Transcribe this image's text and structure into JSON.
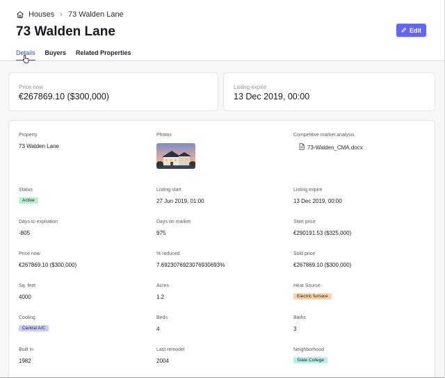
{
  "breadcrumb": {
    "section": "Houses",
    "current": "73 Walden Lane"
  },
  "page": {
    "title": "73 Walden Lane",
    "edit_label": "Edit"
  },
  "tabs": [
    {
      "label": "Details",
      "active": true
    },
    {
      "label": "Buyers",
      "active": false
    },
    {
      "label": "Related Properties",
      "active": false
    }
  ],
  "summary": {
    "price_label": "Price now",
    "price_value": "€267869.10 ($300,000)",
    "expire_label": "Listing expire",
    "expire_value": "13 Dec 2019, 00:00"
  },
  "details": {
    "property": {
      "label": "Property",
      "value": "73 Walden Lane"
    },
    "photos": {
      "label": "Photos"
    },
    "cma": {
      "label": "Competitive market analysis",
      "file": "73-Walden_CMA.docx"
    },
    "status": {
      "label": "Status",
      "value": "Active",
      "color": "#b8f0cf"
    },
    "listing_start": {
      "label": "Listing start",
      "value": "27 Jun 2019, 01:00"
    },
    "listing_expire": {
      "label": "Listing expire",
      "value": "13 Dec 2019, 00:00"
    },
    "days_to_expiration": {
      "label": "Days to expiration",
      "value": "-805"
    },
    "days_on_market": {
      "label": "Days on market",
      "value": "975"
    },
    "start_price": {
      "label": "Start price",
      "value": "€290191.53 ($325,000)"
    },
    "price_now": {
      "label": "Price now",
      "value": "€267869.10 ($300,000)"
    },
    "reduced": {
      "label": "% reduced",
      "value": "7.6923076923076930693%"
    },
    "sold_price": {
      "label": "Sold price",
      "value": "€267869.10 ($300,000)"
    },
    "sq_feet": {
      "label": "Sq. feet",
      "value": "4000"
    },
    "acres": {
      "label": "Acres",
      "value": "1.2"
    },
    "heat_source": {
      "label": "Heat Source",
      "value": "Electric furnace",
      "color": "#fdd2a6"
    },
    "cooling": {
      "label": "Cooling",
      "value": "Central A/C",
      "color": "#c9cdf7"
    },
    "beds": {
      "label": "Beds",
      "value": "4"
    },
    "baths": {
      "label": "Baths",
      "value": "3"
    },
    "built_in": {
      "label": "Built in",
      "value": "1982"
    },
    "last_remodel": {
      "label": "Last remodel",
      "value": "2004"
    },
    "neighborhood": {
      "label": "Neighborhood",
      "value": "State College",
      "color": "#b6f2e3"
    }
  },
  "icons": {
    "home": "home-icon",
    "chevron": "chevron-right-icon",
    "edit": "pencil-icon",
    "file": "document-icon",
    "cursor": "hand-pointer-icon"
  },
  "colors": {
    "accent": "#6366f1",
    "tab_active": "#3d46b8"
  }
}
